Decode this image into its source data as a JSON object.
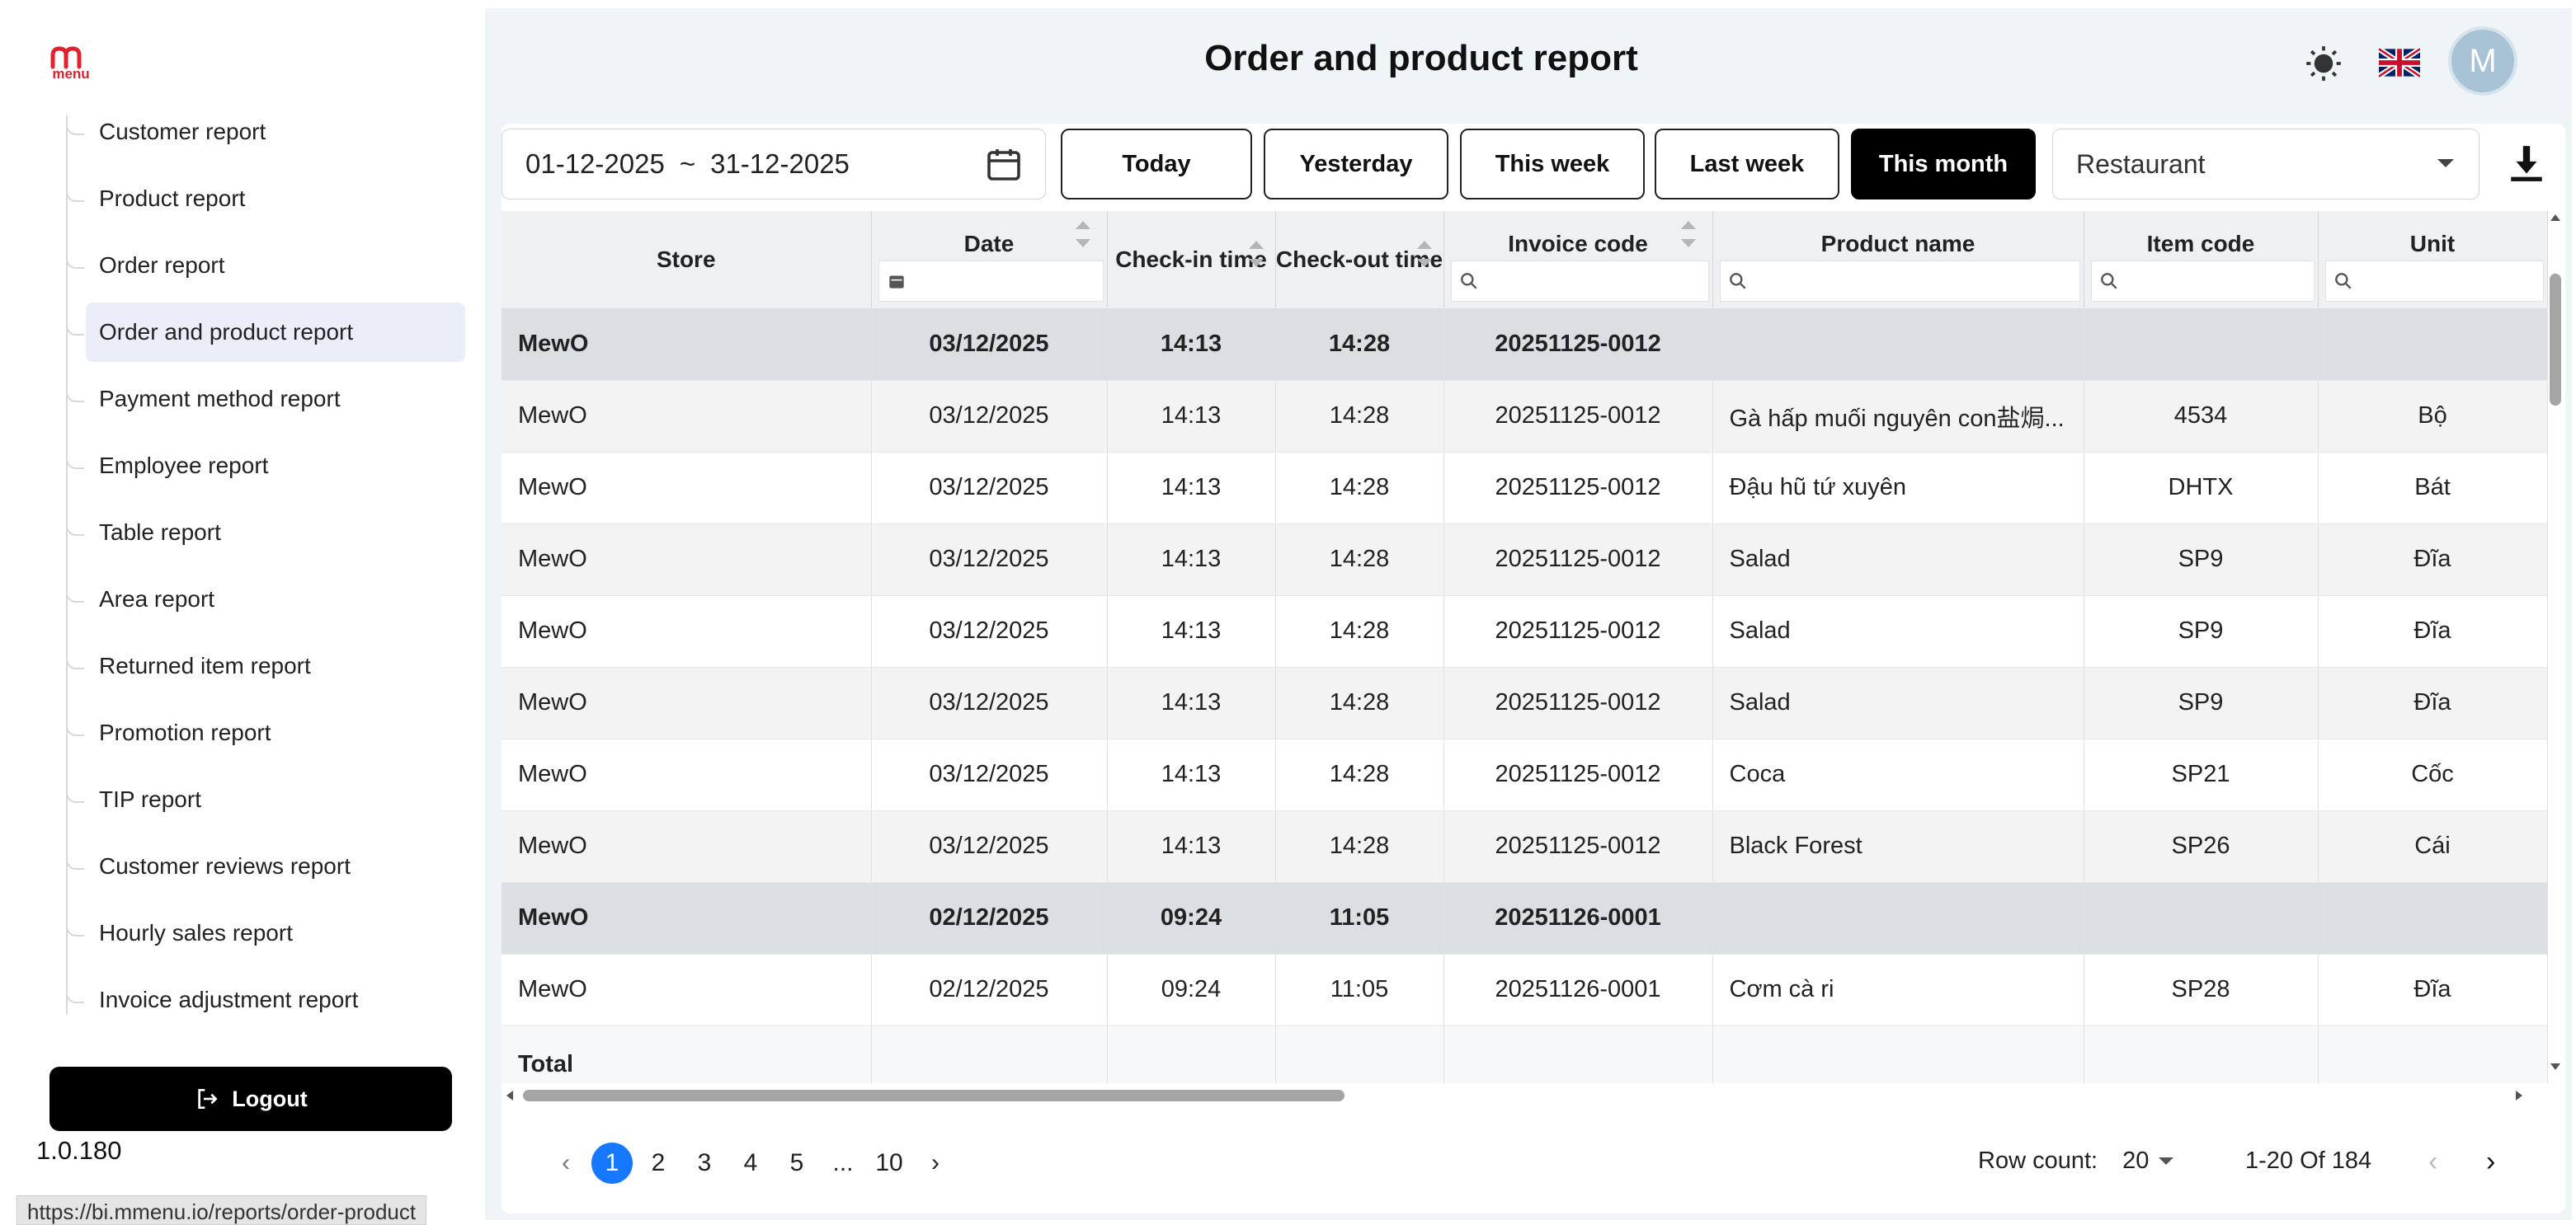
{
  "sidebar": {
    "logo_text": "menu",
    "items": [
      {
        "label": "Customer report",
        "active": false
      },
      {
        "label": "Product report",
        "active": false
      },
      {
        "label": "Order report",
        "active": false
      },
      {
        "label": "Order and product report",
        "active": true
      },
      {
        "label": "Payment method report",
        "active": false
      },
      {
        "label": "Employee report",
        "active": false
      },
      {
        "label": "Table report",
        "active": false
      },
      {
        "label": "Area report",
        "active": false
      },
      {
        "label": "Returned item report",
        "active": false
      },
      {
        "label": "Promotion report",
        "active": false
      },
      {
        "label": "TIP report",
        "active": false
      },
      {
        "label": "Customer reviews report",
        "active": false
      },
      {
        "label": "Hourly sales report",
        "active": false
      },
      {
        "label": "Invoice adjustment report",
        "active": false
      }
    ],
    "logout_label": "Logout",
    "version": "1.0.180"
  },
  "status_bar_url": "https://bi.mmenu.io/reports/order-product",
  "header": {
    "title": "Order and product report",
    "avatar_initial": "M"
  },
  "filters": {
    "date_from": "01-12-2025",
    "date_sep": "~",
    "date_to": "31-12-2025",
    "quick_ranges": [
      "Today",
      "Yesterday",
      "This week",
      "Last week",
      "This month"
    ],
    "active_range": "This month",
    "store_select": "Restaurant"
  },
  "table": {
    "columns": [
      "Store",
      "Date",
      "Check-in time",
      "Check-out time",
      "Invoice code",
      "Product name",
      "Item code",
      "Unit"
    ],
    "rows": [
      {
        "type": "group",
        "cells": [
          "MewO",
          "03/12/2025",
          "14:13",
          "14:28",
          "20251125-0012",
          "",
          "",
          ""
        ]
      },
      {
        "type": "alt",
        "cells": [
          "MewO",
          "03/12/2025",
          "14:13",
          "14:28",
          "20251125-0012",
          "Gà hấp muối nguyên con盐焗...",
          "4534",
          "Bộ"
        ]
      },
      {
        "type": "plain",
        "cells": [
          "MewO",
          "03/12/2025",
          "14:13",
          "14:28",
          "20251125-0012",
          "Đậu hũ tứ xuyên",
          "DHTX",
          "Bát"
        ]
      },
      {
        "type": "alt",
        "cells": [
          "MewO",
          "03/12/2025",
          "14:13",
          "14:28",
          "20251125-0012",
          "Salad",
          "SP9",
          "Đĩa"
        ]
      },
      {
        "type": "plain",
        "cells": [
          "MewO",
          "03/12/2025",
          "14:13",
          "14:28",
          "20251125-0012",
          "Salad",
          "SP9",
          "Đĩa"
        ]
      },
      {
        "type": "alt",
        "cells": [
          "MewO",
          "03/12/2025",
          "14:13",
          "14:28",
          "20251125-0012",
          "Salad",
          "SP9",
          "Đĩa"
        ]
      },
      {
        "type": "plain",
        "cells": [
          "MewO",
          "03/12/2025",
          "14:13",
          "14:28",
          "20251125-0012",
          "Coca",
          "SP21",
          "Cốc"
        ]
      },
      {
        "type": "alt",
        "cells": [
          "MewO",
          "03/12/2025",
          "14:13",
          "14:28",
          "20251125-0012",
          "Black Forest",
          "SP26",
          "Cái"
        ]
      },
      {
        "type": "group",
        "cells": [
          "MewO",
          "02/12/2025",
          "09:24",
          "11:05",
          "20251126-0001",
          "",
          "",
          ""
        ]
      },
      {
        "type": "plain",
        "cells": [
          "MewO",
          "02/12/2025",
          "09:24",
          "11:05",
          "20251126-0001",
          "Cơm cà ri",
          "SP28",
          "Đĩa"
        ]
      }
    ],
    "total_label": "Total"
  },
  "pagination": {
    "pages": [
      "1",
      "2",
      "3",
      "4",
      "5",
      "...",
      "10"
    ],
    "current": "1",
    "row_count_label": "Row count:",
    "row_count_value": "20",
    "range_text": "1-20 Of 184"
  }
}
